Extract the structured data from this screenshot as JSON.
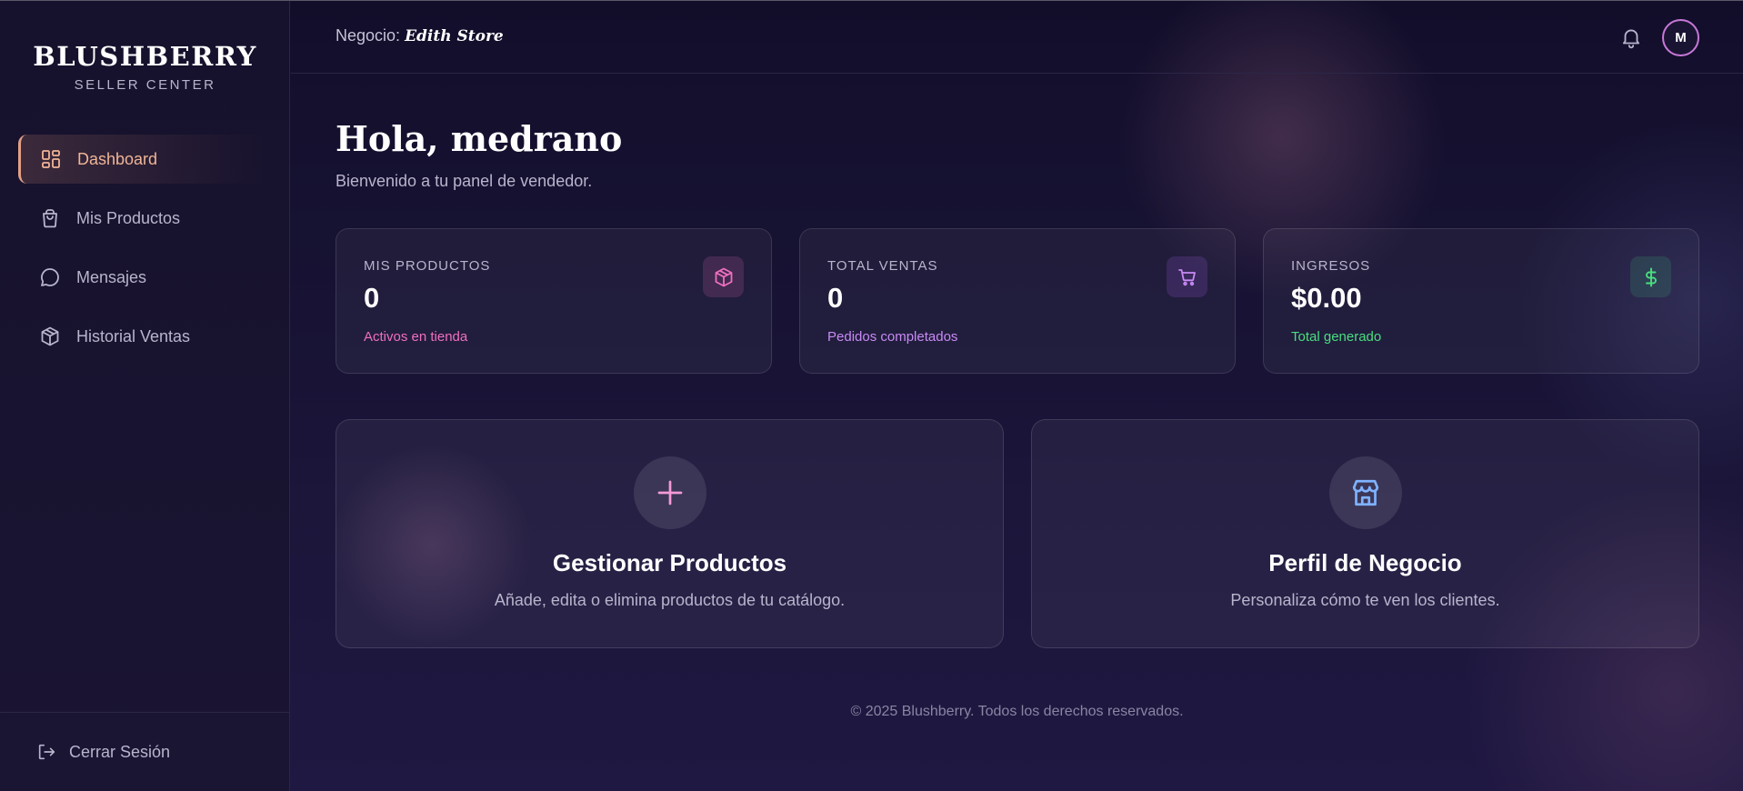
{
  "sidebar": {
    "brand_name": "BLUSHBERRY",
    "brand_sub": "SELLER CENTER",
    "items": [
      {
        "label": "Dashboard",
        "icon": "dashboard-grid-icon"
      },
      {
        "label": "Mis Productos",
        "icon": "shopping-bag-icon"
      },
      {
        "label": "Mensajes",
        "icon": "message-bubble-icon"
      },
      {
        "label": "Historial Ventas",
        "icon": "box-icon"
      }
    ],
    "logout_label": "Cerrar Sesión"
  },
  "header": {
    "business_prefix": "Negocio:",
    "business_name": "Edith Store",
    "avatar_initial": "M"
  },
  "main": {
    "greeting": "Hola, medrano",
    "subtitle": "Bienvenido a tu panel de vendedor.",
    "stats": [
      {
        "label": "MIS PRODUCTOS",
        "value": "0",
        "note": "Activos en tienda",
        "icon": "box-icon",
        "color": "#f06fc0"
      },
      {
        "label": "TOTAL VENTAS",
        "value": "0",
        "note": "Pedidos completados",
        "icon": "cart-icon",
        "color": "#c88af5"
      },
      {
        "label": "INGRESOS",
        "value": "$0.00",
        "note": "Total generado",
        "icon": "dollar-icon",
        "color": "#4ade80"
      }
    ],
    "actions": [
      {
        "title": "Gestionar Productos",
        "desc": "Añade, edita o elimina productos de tu catálogo.",
        "icon": "plus-icon",
        "color": "#f39ad6"
      },
      {
        "title": "Perfil de Negocio",
        "desc": "Personaliza cómo te ven los clientes.",
        "icon": "store-icon",
        "color": "#7fb2ff"
      }
    ],
    "footer": "© 2025 Blushberry. Todos los derechos reservados."
  }
}
